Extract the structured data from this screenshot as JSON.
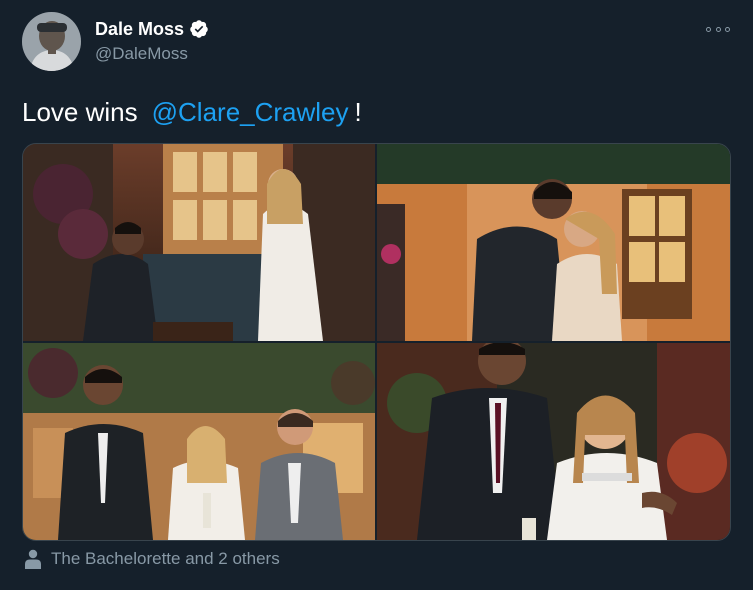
{
  "author": {
    "display_name": "Dale Moss",
    "handle": "@DaleMoss",
    "verified": true,
    "avatar_icon": "avatar-photo"
  },
  "tweet": {
    "text_before": "Love wins",
    "mention": "@Clare_Crawley",
    "text_after": "!"
  },
  "media": {
    "photo_count": 4,
    "photos": [
      {
        "description_icon": "photo-proposal"
      },
      {
        "description_icon": "photo-embrace"
      },
      {
        "description_icon": "photo-group-champagne"
      },
      {
        "description_icon": "photo-couple-portrait"
      }
    ]
  },
  "tagged": {
    "label": "The Bachelorette and 2 others",
    "icon": "person-icon"
  },
  "colors": {
    "background": "#15202b",
    "text_primary": "#ffffff",
    "text_secondary": "#8899a6",
    "link": "#1da1f2",
    "border": "#38444d"
  }
}
